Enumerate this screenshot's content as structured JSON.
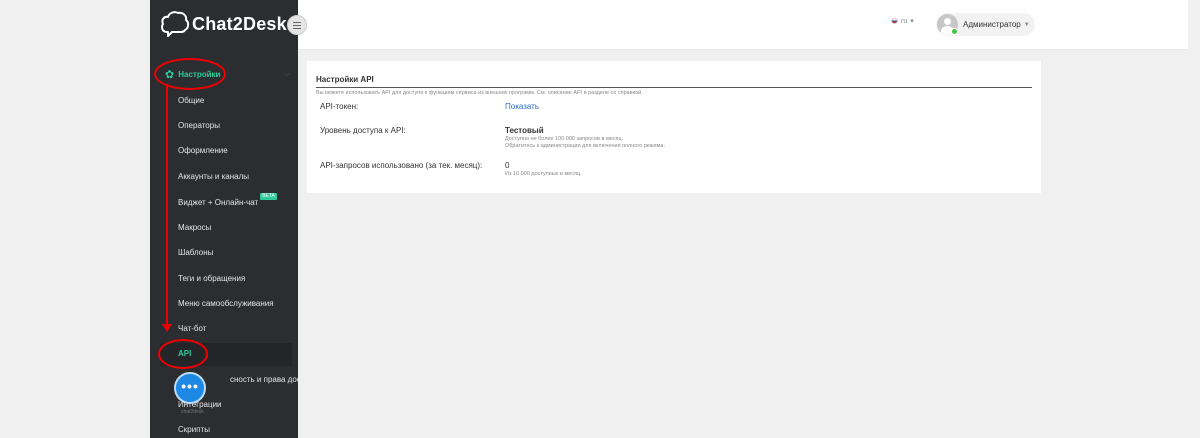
{
  "app": {
    "name": "Chat2Desk"
  },
  "sidebar": {
    "section_label": "Настройки",
    "items": [
      {
        "label": "Общие"
      },
      {
        "label": "Операторы"
      },
      {
        "label": "Оформление"
      },
      {
        "label": "Аккаунты и каналы"
      },
      {
        "label": "Виджет + Онлайн-чат",
        "badge": "BETA"
      },
      {
        "label": "Макросы"
      },
      {
        "label": "Шаблоны"
      },
      {
        "label": "Теги и обращения"
      },
      {
        "label": "Меню самообслуживания"
      },
      {
        "label": "Чат-бот"
      },
      {
        "label": "API",
        "active": true
      },
      {
        "label": "сность и права доступа"
      },
      {
        "label": "Интеграции"
      },
      {
        "label": "Скрипты"
      }
    ],
    "widget_caption": "chat2desk"
  },
  "header": {
    "language": "ru",
    "user_name": "Администратор"
  },
  "api_settings": {
    "title": "Настройки API",
    "description": "Вы можете использовать API для доступа к функциям сервиса из внешних программ. См. описание API в разделе со справкой.",
    "rows": [
      {
        "label": "API-токен:",
        "value": "Показать"
      },
      {
        "label": "Уровень доступа к API:",
        "value": "Тестовый",
        "note1": "Доступно не более 100 000 запросов в месяц.",
        "note2": "Обратитесь к администрации для включения полного режима."
      },
      {
        "label": "API-запросов использовано (за тек. месяц):",
        "value": "0",
        "note1": "Из 10 000 доступных в месяц."
      }
    ]
  },
  "colors": {
    "sidebar_bg": "#2b2d31",
    "accent": "#2ecc9a",
    "annotation": "#e00000",
    "link": "#2a6ec7"
  }
}
